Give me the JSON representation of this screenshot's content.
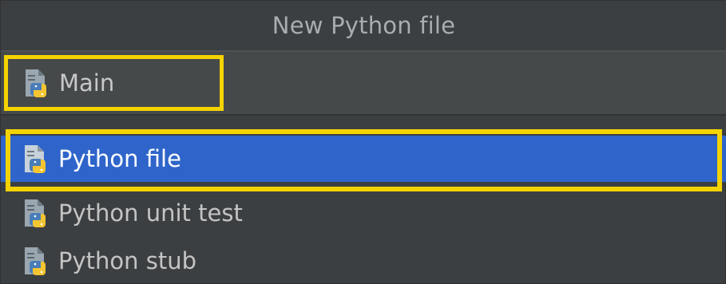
{
  "dialog": {
    "title": "New Python file"
  },
  "name_field": {
    "value": "Main",
    "icon": "python-file-icon"
  },
  "file_types": [
    {
      "label": "Python file",
      "icon": "python-file-icon",
      "selected": true
    },
    {
      "label": "Python unit test",
      "icon": "python-file-icon",
      "selected": false
    },
    {
      "label": "Python stub",
      "icon": "python-file-icon",
      "selected": false
    }
  ],
  "colors": {
    "background": "#3c3f41",
    "selection": "#2f65ca",
    "highlight": "#f5d300",
    "python_blue": "#4a7db8",
    "python_yellow": "#f4c531"
  }
}
